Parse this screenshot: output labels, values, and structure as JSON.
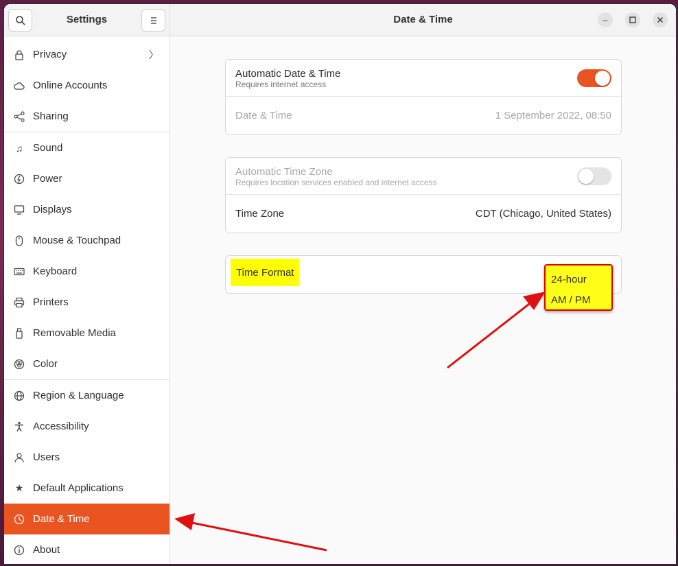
{
  "sidebar": {
    "title": "Settings",
    "items": [
      {
        "label": "Privacy",
        "icon": "lock-icon"
      },
      {
        "label": "Online Accounts",
        "icon": "cloud-icon"
      },
      {
        "label": "Sharing",
        "icon": "share-icon"
      },
      {
        "label": "Sound",
        "icon": "music-note-icon"
      },
      {
        "label": "Power",
        "icon": "power-icon"
      },
      {
        "label": "Displays",
        "icon": "display-icon"
      },
      {
        "label": "Mouse & Touchpad",
        "icon": "mouse-icon"
      },
      {
        "label": "Keyboard",
        "icon": "keyboard-icon"
      },
      {
        "label": "Printers",
        "icon": "printer-icon"
      },
      {
        "label": "Removable Media",
        "icon": "usb-drive-icon"
      },
      {
        "label": "Color",
        "icon": "color-icon"
      },
      {
        "label": "Region & Language",
        "icon": "globe-icon"
      },
      {
        "label": "Accessibility",
        "icon": "accessibility-icon"
      },
      {
        "label": "Users",
        "icon": "user-icon"
      },
      {
        "label": "Default Applications",
        "icon": "star-icon"
      },
      {
        "label": "Date & Time",
        "icon": "clock-icon",
        "active": true
      },
      {
        "label": "About",
        "icon": "info-icon"
      }
    ]
  },
  "main": {
    "title": "Date & Time",
    "auto_datetime": {
      "label": "Automatic Date & Time",
      "sub": "Requires internet access",
      "enabled": true
    },
    "datetime": {
      "label": "Date & Time",
      "value": "1 September 2022, 08:50"
    },
    "auto_timezone": {
      "label": "Automatic Time Zone",
      "sub": "Requires location services enabled and internet access",
      "enabled": false
    },
    "timezone": {
      "label": "Time Zone",
      "value": "CDT (Chicago, United States)"
    },
    "time_format": {
      "label": "Time Format",
      "options": [
        "24-hour",
        "AM / PM"
      ]
    }
  },
  "colors": {
    "accent": "#e95420",
    "highlight": "#ffff00",
    "annotation": "#e00000"
  }
}
